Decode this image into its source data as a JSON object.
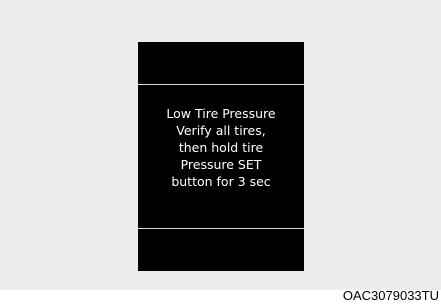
{
  "display": {
    "message_lines": [
      "Low Tire Pressure",
      "Verify all tires,",
      "then hold tire",
      "Pressure SET",
      "button for 3 sec"
    ]
  },
  "figure": {
    "code": "OAC3079033TU"
  }
}
